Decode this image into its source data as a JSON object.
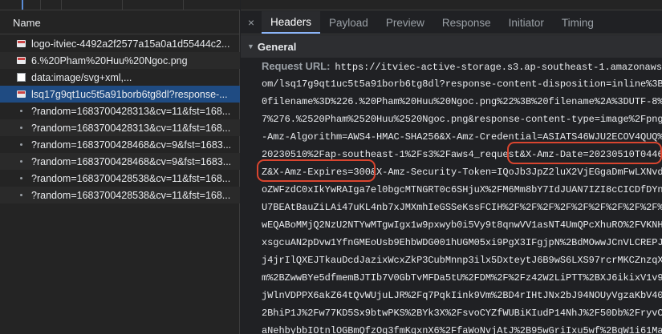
{
  "requests": {
    "header": "Name",
    "items": [
      {
        "icon": "image-icon",
        "label": "logo-itviec-4492a2f2577a15a0a1d55444c2..."
      },
      {
        "icon": "image-icon",
        "label": "6.%20Pham%20Huu%20Ngoc.png"
      },
      {
        "icon": "blank-document-icon",
        "label": "data:image/svg+xml,..."
      },
      {
        "icon": "image-icon",
        "label": "lsq17g9qt1uc5t5a91borb6tg8dl?response-..."
      },
      {
        "icon": "dot-icon",
        "label": "?random=1683700428313&cv=11&fst=168..."
      },
      {
        "icon": "dot-icon",
        "label": "?random=1683700428313&cv=11&fst=168..."
      },
      {
        "icon": "dot-icon",
        "label": "?random=1683700428468&cv=9&fst=1683..."
      },
      {
        "icon": "dot-icon",
        "label": "?random=1683700428468&cv=9&fst=1683..."
      },
      {
        "icon": "dot-icon",
        "label": "?random=1683700428538&cv=11&fst=168..."
      },
      {
        "icon": "dot-icon",
        "label": "?random=1683700428538&cv=11&fst=168..."
      }
    ]
  },
  "detail": {
    "close_label": "×",
    "tabs": [
      "Headers",
      "Payload",
      "Preview",
      "Response",
      "Initiator",
      "Timing"
    ],
    "section_title": "General",
    "request_url_label": "Request URL:",
    "url_lines": [
      "https://itviec-active-storage.s3.ap-southeast-1.amazonaws.c",
      "om/lsq17g9qt1uc5t5a91borb6tg8dl?response-content-disposition=inline%3B%2",
      "0filename%3D%226.%20Pham%20Huu%20Ngoc.png%22%3B%20filename%2A%3DUTF-8%2",
      "7%276.%2520Pham%2520Huu%2520Ngoc.png&response-content-type=image%2Fpng&X",
      "-Amz-Algorithm=AWS4-HMAC-SHA256&X-Amz-Credential=ASIATS46WJU2ECOV4QUQ%2F",
      "20230510%2Fap-southeast-1%2Fs3%2Faws4_request&X-Amz-Date=20230510T044640",
      "Z&X-Amz-Expires=300&X-Amz-Security-Token=IQoJb3JpZ2luX2VjEGgaDmFwLXNvdXR",
      "oZWFzdC0xIkYwRAIga7el0bgcMTNGRT0c6SHjuX%2FM6Mm8bY7IdJUAN7IZI8cCICDfDYnbN",
      "U7BEAtBauZiLAi47uKL4nb7xJMXmhIeGSSeKssFCIH%2F%2F%2F%2F%2F%2F%2F%2F%2F%2F",
      "wEQABoMMjQ2NzU2NTYwMTgwIgx1w9pxwyb0i5Vy9t8qnwVV1asNT4UmQPcXhuRO%2FVKNHFS",
      "xsgcuAN2pDvw1YfnGMEoUsb9EhbWDG001hUGM05xi9PgX3IFgjpN%2BdMOwwJCnVLCREPJOy",
      "j4jrIlQXEJTkauDcdJazixWcxZkP3CubMnnp3ilx5DxteytJ6B9wS6LXS97rcrMKCZnzqX6c",
      "m%2BZwwBYe5dfmemBJTIb7V0GbTvMFDa5tU%2FDM%2F%2Fz42W2LiPTT%2BXJ6ikixV1v9hH",
      "jWlnVDPPX6akZ64tQvWUjuLJR%2Fq7PqkIink9Vm%2BD4rIHtJNx2bJ94NOUyVgzaKbV40S%",
      "2BhiP1J%2Fw77KD5Sx9btwPKS%2BYk3X%2FsvoCYZfWUBiKIudP14NhJ%2F50Db%2FryvCsR",
      "aNehbybbIOtnlOGBmQfzOq3fmKqxnX6%2FfaWoNvjAtJ%2B95wGriIxu5wf%2BqW1i61MaoT"
    ],
    "highlights": [
      "X-Amz-Date=20230510T044640",
      "Z&X-Amz-Expires=300&"
    ]
  },
  "colors": {
    "selected_row": "#1f4b82",
    "active_tab_underline": "#8ab4f8",
    "highlight_outline": "#d9452f"
  }
}
